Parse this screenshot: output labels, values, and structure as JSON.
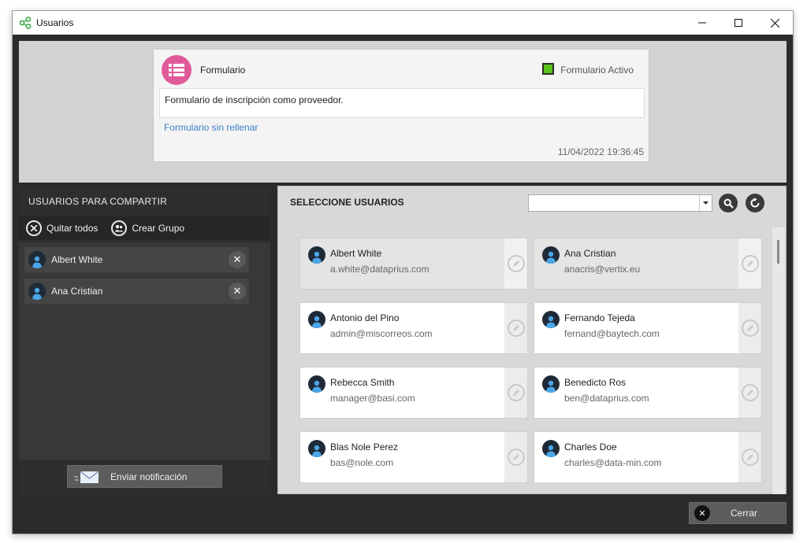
{
  "window": {
    "title": "Usuarios"
  },
  "form": {
    "title": "Formulario",
    "active_label": "Formulario Activo",
    "description": "Formulario de inscripción como proveedor.",
    "link": "Formulario sin rellenar",
    "date": "11/04/2022 19:36:45",
    "accent_color": "#e05a9a",
    "active_color": "#59c21d"
  },
  "left": {
    "title": "USUARIOS PARA COMPARTIR",
    "remove_all": "Quitar todos",
    "create_group": "Crear Grupo",
    "selected": [
      "Albert White",
      "Ana Cristian"
    ],
    "notify_button": "Enviar notificación"
  },
  "right": {
    "title": "SELECCIONE USUARIOS",
    "search_value": "",
    "users": [
      {
        "name": "Albert White",
        "email": "a.white@dataprius.com",
        "selected": true
      },
      {
        "name": "Ana Cristian",
        "email": "anacris@vertix.eu",
        "selected": true
      },
      {
        "name": "Antonio del Pino",
        "email": "admin@miscorreos.com",
        "selected": false
      },
      {
        "name": "Fernando Tejeda",
        "email": "fernand@baytech.com",
        "selected": false
      },
      {
        "name": "Rebecca Smith",
        "email": "manager@basi.com",
        "selected": false
      },
      {
        "name": "Benedicto Ros",
        "email": "ben@dataprius.com",
        "selected": false
      },
      {
        "name": "Blas Nole Perez",
        "email": "bas@nole.com",
        "selected": false
      },
      {
        "name": "Charles Doe",
        "email": "charles@data-min.com",
        "selected": false
      }
    ]
  },
  "footer": {
    "close_button": "Cerrar"
  }
}
